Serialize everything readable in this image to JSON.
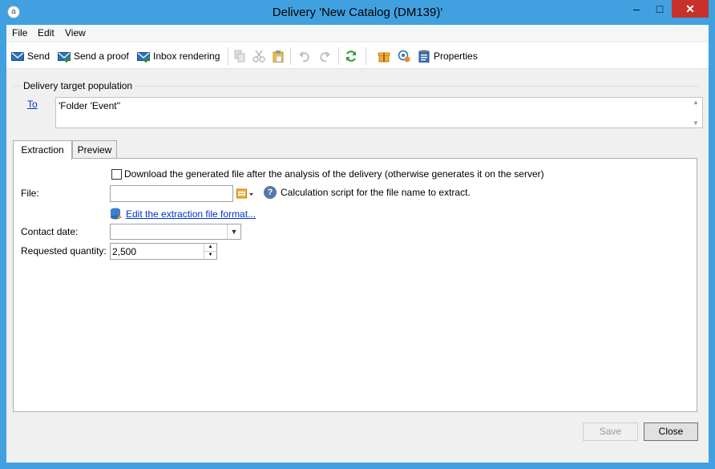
{
  "window": {
    "title": "Delivery 'New Catalog (DM139)'"
  },
  "menu": [
    "File",
    "Edit",
    "View"
  ],
  "toolbar": {
    "send": "Send",
    "send_proof": "Send a proof",
    "inbox_rendering": "Inbox rendering",
    "properties": "Properties"
  },
  "target": {
    "group_label": "Delivery target population",
    "to_link": "To",
    "value": "'Folder 'Event''"
  },
  "tabs": [
    "Extraction",
    "Preview"
  ],
  "extraction": {
    "download_checkbox_label": "Download the generated file after the analysis of the delivery (otherwise generates it on the server)",
    "download_checked": false,
    "file_label": "File:",
    "file_value": "",
    "calc_script_text": "Calculation script for the file name to extract.",
    "edit_format_link": "Edit the extraction file format...",
    "contact_date_label": "Contact date:",
    "contact_date_value": "",
    "requested_quantity_label": "Requested quantity:",
    "requested_quantity_value": "2,500"
  },
  "footer": {
    "save": "Save",
    "close": "Close"
  },
  "colors": {
    "titlebar": "#41a1e0",
    "close_button": "#c7302b",
    "link": "#0033cc"
  }
}
